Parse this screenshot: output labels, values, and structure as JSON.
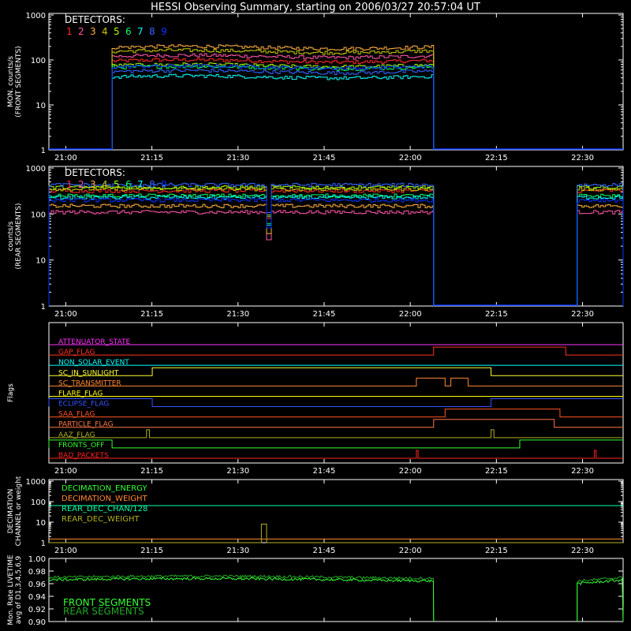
{
  "title": "HESSI Observing Summary, starting on 2006/03/27 20:57:04 UT",
  "colors": {
    "frame": "#ffffff",
    "detector": [
      "#ffffff",
      "#ff2a2a",
      "#ff55aa",
      "#ffb040",
      "#c8c800",
      "#aaff00",
      "#00ff66",
      "#00ffff",
      "#3366ff",
      "#0033ff"
    ]
  },
  "time_axis": {
    "start": "20:57:04",
    "end": "22:37:00",
    "tick_labels": [
      "21:00",
      "21:15",
      "21:30",
      "21:45",
      "22:00",
      "22:15",
      "22:30"
    ],
    "tick_minutes": [
      0,
      15,
      30,
      45,
      60,
      75,
      90
    ]
  },
  "chart_data": [
    {
      "type": "line",
      "ylabel": [
        "MON. counts/s",
        "(FRONT SEGMENTS)"
      ],
      "y_log": true,
      "ylim": [
        1,
        1000
      ],
      "y_tick_labels": [
        "1",
        "10",
        "100",
        "1000"
      ],
      "legend_title": "DETECTORS:",
      "legend_entries": [
        "1",
        "2",
        "3",
        "4",
        "5",
        "6",
        "7",
        "8",
        "9"
      ],
      "series": [
        {
          "det": 1,
          "level": 95,
          "segments": [
            [
              "21:08",
              "22:04"
            ]
          ]
        },
        {
          "det": 2,
          "level": 120,
          "segments": [
            [
              "21:08",
              "22:04"
            ]
          ]
        },
        {
          "det": 3,
          "level": 190,
          "segments": [
            [
              "21:08",
              "22:04"
            ]
          ]
        },
        {
          "det": 4,
          "level": 155,
          "segments": [
            [
              "21:08",
              "22:04"
            ]
          ]
        },
        {
          "det": 5,
          "level": 75,
          "segments": [
            [
              "21:08",
              "22:04"
            ]
          ]
        },
        {
          "det": 6,
          "level": 68,
          "segments": [
            [
              "21:08",
              "22:04"
            ]
          ]
        },
        {
          "det": 7,
          "level": 42,
          "segments": [
            [
              "21:08",
              "22:04"
            ]
          ]
        },
        {
          "det": 8,
          "level": 55,
          "segments": [
            [
              "21:08",
              "22:04"
            ]
          ]
        },
        {
          "det": 9,
          "level": 70,
          "segments": [
            [
              "21:08",
              "22:04"
            ]
          ]
        }
      ]
    },
    {
      "type": "line",
      "ylabel": [
        "counts/s",
        "(REAR SEGMENTS)"
      ],
      "y_log": true,
      "ylim": [
        1,
        1000
      ],
      "y_tick_labels": [
        "1",
        "10",
        "100",
        "1000"
      ],
      "legend_title": "DETECTORS:",
      "legend_entries": [
        "1",
        "2",
        "3",
        "4",
        "5",
        "6",
        "7",
        "8",
        "9"
      ],
      "series": [
        {
          "det": 1,
          "level": 320,
          "segments": [
            [
              "20:57",
              "22:04"
            ],
            [
              "22:29",
              "22:37"
            ]
          ]
        },
        {
          "det": 2,
          "level": 110,
          "segments": [
            [
              "20:57",
              "22:04"
            ],
            [
              "22:29",
              "22:37"
            ]
          ]
        },
        {
          "det": 3,
          "level": 150,
          "segments": [
            [
              "20:57",
              "22:04"
            ],
            [
              "22:29",
              "22:37"
            ]
          ]
        },
        {
          "det": 4,
          "level": 350,
          "segments": [
            [
              "20:57",
              "22:04"
            ],
            [
              "22:29",
              "22:37"
            ]
          ]
        },
        {
          "det": 5,
          "level": 380,
          "segments": [
            [
              "20:57",
              "22:04"
            ],
            [
              "22:29",
              "22:37"
            ]
          ]
        },
        {
          "det": 6,
          "level": 250,
          "segments": [
            [
              "20:57",
              "22:04"
            ],
            [
              "22:29",
              "22:37"
            ]
          ]
        },
        {
          "det": 7,
          "level": 230,
          "segments": [
            [
              "20:57",
              "22:04"
            ],
            [
              "22:29",
              "22:37"
            ]
          ]
        },
        {
          "det": 8,
          "level": 430,
          "segments": [
            [
              "20:57",
              "22:04"
            ],
            [
              "22:29",
              "22:37"
            ]
          ]
        },
        {
          "det": 9,
          "level": 200,
          "segments": [
            [
              "20:57",
              "22:04"
            ],
            [
              "22:29",
              "22:37"
            ]
          ]
        }
      ]
    },
    {
      "type": "line",
      "ylabel": [
        "Flags"
      ],
      "flags": [
        {
          "label": "ATTENUATOR_STATE",
          "color": "#ff33ff",
          "on": []
        },
        {
          "label": "GAP_FLAG",
          "color": "#ff3322",
          "on": [
            [
              "22:04",
              "22:27"
            ]
          ]
        },
        {
          "label": "NON_SOLAR_EVENT",
          "color": "#00ffff",
          "on": []
        },
        {
          "label": "SC_IN_SUNLIGHT",
          "color": "#ffff33",
          "on": [
            [
              "21:15",
              "22:14"
            ]
          ]
        },
        {
          "label": "SC_TRANSMITTER",
          "color": "#ff8833",
          "on": [
            [
              "22:01",
              "22:06"
            ],
            [
              "22:07",
              "22:10"
            ]
          ]
        },
        {
          "label": "FLARE_FLAG",
          "color": "#ffff00",
          "on": []
        },
        {
          "label": "ECLIPSE_FLAG",
          "color": "#3355ff",
          "on": [
            [
              "20:57",
              "21:15"
            ],
            [
              "22:14",
              "22:37"
            ]
          ]
        },
        {
          "label": "SAA_FLAG",
          "color": "#ff5522",
          "on": [
            [
              "22:06",
              "22:26"
            ]
          ]
        },
        {
          "label": "PARTICLE_FLAG",
          "color": "#ff7744",
          "on": [
            [
              "22:04",
              "22:25"
            ]
          ]
        },
        {
          "label": "AAZ_FLAG",
          "color": "#b0b020",
          "on": [
            [
              "21:14",
              "21:14.5"
            ],
            [
              "22:14",
              "22:14.5"
            ]
          ]
        },
        {
          "label": "FRONTS_OFF",
          "color": "#33ff33",
          "on": [
            [
              "20:57",
              "21:08"
            ],
            [
              "22:19",
              "22:37"
            ]
          ]
        },
        {
          "label": "BAD_PACKETS",
          "color": "#ff2222",
          "on": [
            [
              "22:01",
              "22:01.3"
            ],
            [
              "22:32",
              "22:32.3"
            ]
          ]
        }
      ]
    },
    {
      "type": "line",
      "ylabel": [
        "DECIMATION",
        "CHANNEL or weight"
      ],
      "y_log": true,
      "ylim": [
        1,
        1000
      ],
      "y_tick_labels": [
        "1",
        "10",
        "100",
        "1000"
      ],
      "series": [
        {
          "name": "DECIMATION_ENERGY",
          "color": "#33ff33",
          "level": 0
        },
        {
          "name": "DECIMATION_WEIGHT",
          "color": "#ff8833",
          "level": 1.5
        },
        {
          "name": "REAR_DEC_CHAN/128",
          "color": "#00ffaa",
          "level": 64
        },
        {
          "name": "REAR_DEC_WEIGHT",
          "color": "#b0b020",
          "level": 1,
          "spike": {
            "from": "21:34",
            "to": "21:34.5",
            "value": 8
          }
        }
      ]
    },
    {
      "type": "line",
      "ylabel": [
        "Mon. Rate LIVETIME",
        "avg of D1,3,4,5,6,9"
      ],
      "ylim": [
        0.9,
        1.0
      ],
      "y_tick_labels": [
        "0.90",
        "0.92",
        "0.94",
        "0.96",
        "0.98",
        "1.00"
      ],
      "y_tick_values": [
        0.9,
        0.92,
        0.94,
        0.96,
        0.98,
        1.0
      ],
      "series": [
        {
          "name": "FRONT SEGMENTS",
          "color": "#33ff33",
          "level": 0.966,
          "segments": [
            [
              "20:57",
              "22:04"
            ],
            [
              "22:29",
              "22:37"
            ]
          ]
        },
        {
          "name": "REAR SEGMENTS",
          "color": "#22aa22",
          "level": 0.97,
          "segments": [
            [
              "20:57",
              "22:04"
            ],
            [
              "22:29",
              "22:37"
            ]
          ]
        }
      ]
    }
  ]
}
